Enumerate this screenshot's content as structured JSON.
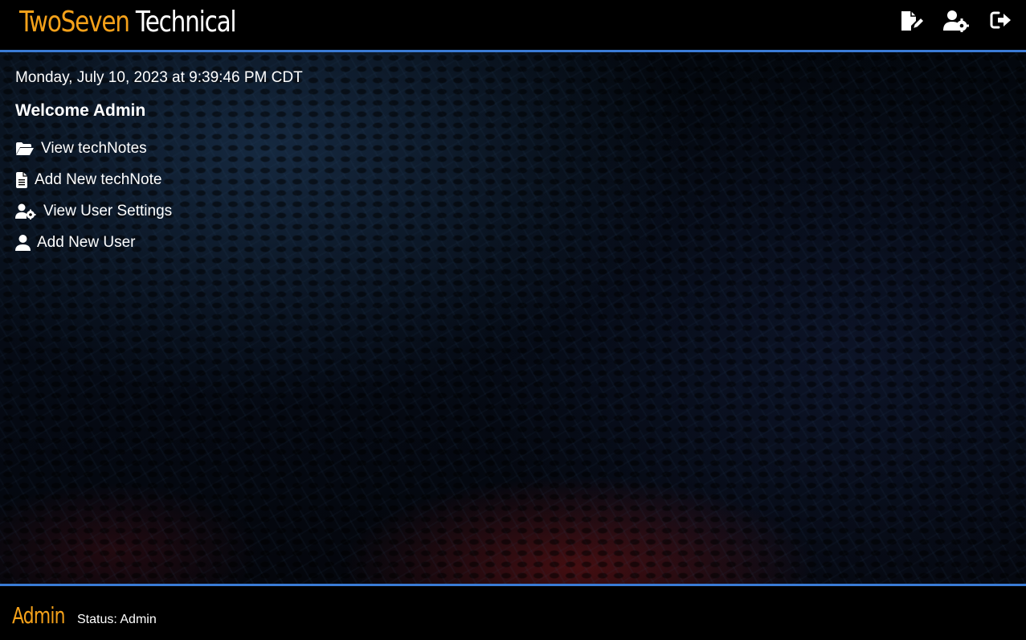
{
  "header": {
    "brand_part1": "TwoSeven",
    "brand_part2": "Technical",
    "icons": [
      "add-note-icon",
      "user-settings-icon",
      "logout-icon"
    ]
  },
  "main": {
    "datetime": "Monday, July 10, 2023 at 9:39:46 PM CDT",
    "welcome": "Welcome Admin",
    "menu": [
      {
        "label": "View techNotes",
        "icon": "folder-open-icon"
      },
      {
        "label": "Add New techNote",
        "icon": "file-icon"
      },
      {
        "label": "View User Settings",
        "icon": "user-gear-icon"
      },
      {
        "label": "Add New User",
        "icon": "user-icon"
      }
    ]
  },
  "footer": {
    "user": "Admin",
    "status": "Status: Admin"
  },
  "colors": {
    "accent": "#f4a11a",
    "border": "#3a7bd5",
    "background": "#000000",
    "text": "#ffffff"
  }
}
